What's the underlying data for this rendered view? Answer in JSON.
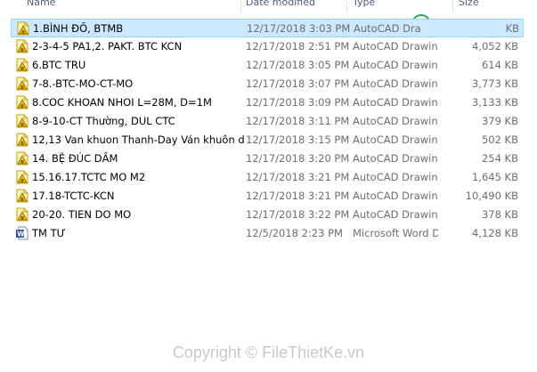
{
  "columns": {
    "name": "Name",
    "date": "Date modified",
    "type": "Type",
    "size": "Size"
  },
  "files": [
    {
      "name": "1.BÌNH ĐỒ, BTMB",
      "date": "12/17/2018 3:03 PM",
      "type": "AutoCAD Dra",
      "size": "KB",
      "icon": "autocad-drawing-icon",
      "selected": true
    },
    {
      "name": "2-3-4-5 PA1,2. PAKT. BTC KCN",
      "date": "12/17/2018 2:51 PM",
      "type": "AutoCAD Drawing",
      "size": "4,052 KB",
      "icon": "autocad-drawing-icon"
    },
    {
      "name": "6.BTC TRU",
      "date": "12/17/2018 3:05 PM",
      "type": "AutoCAD Drawing",
      "size": "614 KB",
      "icon": "autocad-drawing-icon"
    },
    {
      "name": "7-8.-BTC-MO-CT-MO",
      "date": "12/17/2018 3:07 PM",
      "type": "AutoCAD Drawing",
      "size": "3,773 KB",
      "icon": "autocad-drawing-icon"
    },
    {
      "name": "8.COC KHOAN NHOI L=28M, D=1M",
      "date": "12/17/2018 3:09 PM",
      "type": "AutoCAD Drawing",
      "size": "3,133 KB",
      "icon": "autocad-drawing-icon"
    },
    {
      "name": "8-9-10-CT Thường, DUL CTC",
      "date": "12/17/2018 3:11 PM",
      "type": "AutoCAD Drawing",
      "size": "379 KB",
      "icon": "autocad-drawing-icon"
    },
    {
      "name": "12,13 Van khuon Thanh-Day Ván khuôn d...",
      "date": "12/17/2018 3:15 PM",
      "type": "AutoCAD Drawing",
      "size": "502 KB",
      "icon": "autocad-drawing-icon"
    },
    {
      "name": "14. BỆ ĐÚC DẦM",
      "date": "12/17/2018 3:20 PM",
      "type": "AutoCAD Drawing",
      "size": "254 KB",
      "icon": "autocad-drawing-icon"
    },
    {
      "name": "15.16.17.TCTC MO M2",
      "date": "12/17/2018 3:21 PM",
      "type": "AutoCAD Drawing",
      "size": "1,645 KB",
      "icon": "autocad-drawing-icon"
    },
    {
      "name": "17.18-TCTC-KCN",
      "date": "12/17/2018 3:21 PM",
      "type": "AutoCAD Drawing",
      "size": "10,490 KB",
      "icon": "autocad-drawing-icon"
    },
    {
      "name": "20-20. TIEN DO MO",
      "date": "12/17/2018 3:22 PM",
      "type": "AutoCAD Drawing",
      "size": "378 KB",
      "icon": "autocad-drawing-icon"
    },
    {
      "name": "TM TƯ",
      "date": "12/5/2018 2:23 PM",
      "type": "Microsoft Word D...",
      "size": "4,128 KB",
      "icon": "word-document-icon"
    }
  ],
  "watermark": {
    "logo_prefix": "File",
    "logo_suffix": "Thiết Kế",
    "logo_domain": ".vn",
    "copyright": "Copyright © FileThietKe.vn"
  },
  "colors": {
    "selection_bg": "#cce8ff",
    "selection_border": "#99d1ff",
    "autocad_yellow": "#f2c200",
    "word_blue": "#2b579a",
    "logo_green": "#2fa84f",
    "logo_red": "#e03a2f"
  }
}
